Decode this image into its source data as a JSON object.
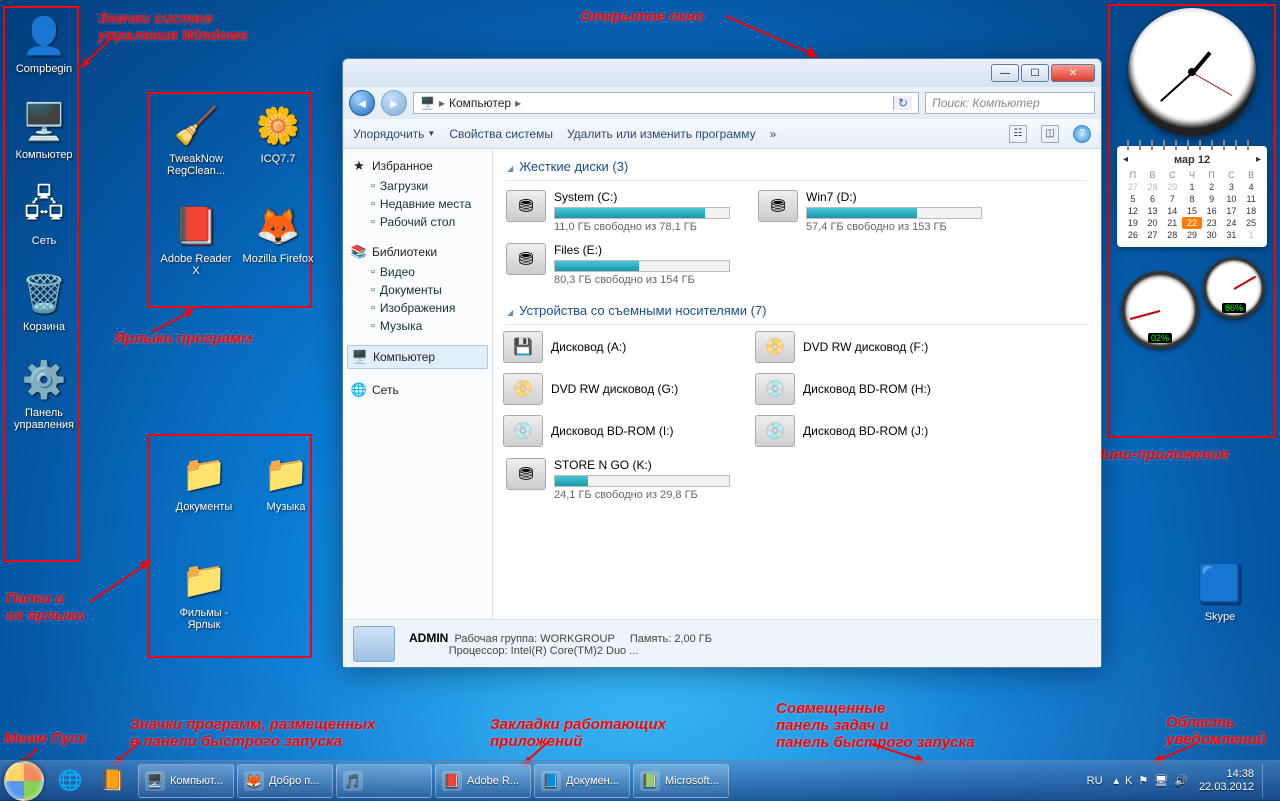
{
  "annotations": {
    "system_icons": "Значки систем\nупраления Windows",
    "shortcuts": "Ярлыки программ",
    "folders": "Папки и\nих ярлыки",
    "open_window": "Открытое окно",
    "gadgets": "Мини-приложения",
    "start_menu": "Меню Пуск",
    "quick_launch": "Значки программ, размещенных\nв панели быстрого запуска",
    "running_tabs": "Закладки работающих\nприложений",
    "taskbar_combo": "Совмещенные\nпанель задач и\nпанель быстрого запуска",
    "notification": "Область\nуведомлений"
  },
  "desktop": {
    "system": [
      {
        "label": "Compbegin",
        "glyph": "👤"
      },
      {
        "label": "Компьютер",
        "glyph": "🖥️"
      },
      {
        "label": "Сеть",
        "glyph": "🖧"
      },
      {
        "label": "Корзина",
        "glyph": "🗑️"
      },
      {
        "label": "Панель управления",
        "glyph": "⚙️"
      }
    ],
    "programs": [
      {
        "label": "TweakNow RegClean...",
        "glyph": "🧹"
      },
      {
        "label": "ICQ7.7",
        "glyph": "🌼"
      },
      {
        "label": "Adobe Reader X",
        "glyph": "📕"
      },
      {
        "label": "Mozilla Firefox",
        "glyph": "🦊"
      }
    ],
    "folders": [
      {
        "label": "Документы",
        "glyph": "📁"
      },
      {
        "label": "Музыка",
        "glyph": "📁"
      },
      {
        "label": "Фильмы - Ярлык",
        "glyph": "📁"
      }
    ],
    "skype": {
      "label": "Skype",
      "glyph": "🔵"
    }
  },
  "window": {
    "back": "◄",
    "forward": "►",
    "crumb_icon": "🖥️",
    "crumb": "Компьютер",
    "search_placeholder": "Поиск: Компьютер",
    "toolbar": {
      "organize": "Упорядочить",
      "properties": "Свойства системы",
      "uninstall": "Удалить или изменить программу",
      "more": "»"
    },
    "nav": {
      "favorites": "Избранное",
      "fav_items": [
        "Загрузки",
        "Недавние места",
        "Рабочий стол"
      ],
      "libraries": "Библиотеки",
      "lib_items": [
        "Видео",
        "Документы",
        "Изображения",
        "Музыка"
      ],
      "computer": "Компьютер",
      "network": "Сеть"
    },
    "cat_hdd": "Жесткие диски (3)",
    "cat_removable": "Устройства со съемными носителями (7)",
    "hdd": [
      {
        "name": "System (C:)",
        "free": "11,0 ГБ свободно из 78,1 ГБ",
        "fill": 86
      },
      {
        "name": "Win7 (D:)",
        "free": "57,4 ГБ свободно из 153 ГБ",
        "fill": 63
      },
      {
        "name": "Files (E:)",
        "free": "80,3 ГБ свободно из 154 ГБ",
        "fill": 48
      }
    ],
    "removable": [
      {
        "name": "Дисковод (A:)",
        "glyph": "💾"
      },
      {
        "name": "DVD RW дисковод (F:)",
        "glyph": "📀"
      },
      {
        "name": "DVD RW дисковод (G:)",
        "glyph": "📀"
      },
      {
        "name": "Дисковод BD-ROM (H:)",
        "glyph": "💿"
      },
      {
        "name": "Дисковод BD-ROM (I:)",
        "glyph": "💿"
      },
      {
        "name": "Дисковод BD-ROM (J:)",
        "glyph": "💿"
      }
    ],
    "storengo": {
      "name": "STORE N GO (K:)",
      "free": "24,1 ГБ свободно из 29,8 ГБ",
      "fill": 19
    },
    "status": {
      "user": "ADMIN",
      "wg_label": "Рабочая группа:",
      "wg": "WORKGROUP",
      "mem_label": "Память:",
      "mem": "2,00 ГБ",
      "cpu_label": "Процессор:",
      "cpu": "Intel(R) Core(TM)2 Duo ..."
    }
  },
  "gadgets": {
    "calendar": {
      "month": "мар 12",
      "dow": [
        "П",
        "В",
        "С",
        "Ч",
        "П",
        "С",
        "В"
      ],
      "prev": [
        27,
        28,
        29
      ],
      "days_start": 1,
      "days_end": 31,
      "today": 22,
      "next": [
        1
      ]
    },
    "cpu": {
      "g1": "02%",
      "g2": "86%"
    }
  },
  "taskbar": {
    "quick": [
      "🌐",
      "📙"
    ],
    "tasks": [
      {
        "icon": "🖥️",
        "label": "Компьют..."
      },
      {
        "icon": "🦊",
        "label": "Добро п..."
      },
      {
        "icon": "🎵",
        "label": ""
      },
      {
        "icon": "📕",
        "label": "Adobe R..."
      },
      {
        "icon": "📘",
        "label": "Докумен..."
      },
      {
        "icon": "📗",
        "label": "Microsoft..."
      }
    ],
    "lang": "RU",
    "tray_icons": [
      "▴",
      "K",
      "⚑",
      "🖥",
      "🔊"
    ],
    "time": "14:38",
    "date": "22.03.2012"
  }
}
